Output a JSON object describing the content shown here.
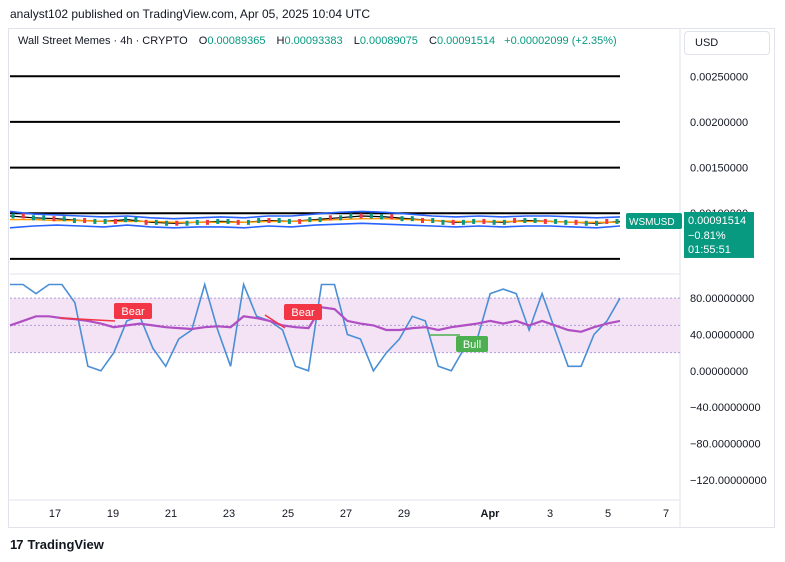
{
  "header": {
    "published": "analyst102 published on TradingView.com, Apr 05, 2025 10:04 UTC"
  },
  "legend": {
    "symbol": "Wall Street Memes · 4h · CRYPTO",
    "o_label": "O",
    "o": "0.00089365",
    "h_label": "H",
    "h": "0.00093383",
    "l_label": "L",
    "l": "0.00089075",
    "c_label": "C",
    "c": "0.00091514",
    "change": "+0.00002099 (+2.35%)"
  },
  "currency_button": "USD",
  "price_tag": {
    "ticker": "WSMUSD",
    "price": "0.00091514",
    "change": "−0.81%",
    "countdown": "01:55:51"
  },
  "colors": {
    "up": "#089981",
    "down": "#f23645",
    "bb": "#2962ff",
    "ma": "#ff9800",
    "stoch_k": "#4a8fd6",
    "stoch_d": "#b04ec4",
    "band": "#f3e3f5"
  },
  "footer": {
    "brand": "TradingView"
  },
  "chart_data": [
    {
      "type": "line",
      "panel": "price",
      "y_axis_ticks": [
        "0.00250000",
        "0.00200000",
        "0.00150000",
        "0.00100000"
      ],
      "ylim": [
        0.0004,
        0.0027
      ],
      "horizontal_lines": [
        0.0025,
        0.002,
        0.0015,
        0.001,
        0.0005
      ],
      "x_ticks": [
        "17",
        "19",
        "21",
        "23",
        "25",
        "27",
        "29",
        "Apr",
        "3",
        "5",
        "7"
      ],
      "series": [
        {
          "values": [
            0.00097,
            0.00095,
            0.00094,
            0.00092,
            0.00091,
            0.00093,
            0.0009,
            0.00089,
            0.0009,
            0.00091,
            0.0009,
            0.00092,
            0.00091,
            0.00093,
            0.00095,
            0.00097,
            0.00096,
            0.00094,
            0.00092,
            0.0009,
            0.00091,
            0.0009,
            0.00092,
            0.00091,
            0.0009,
            0.00089,
            0.00091
          ]
        },
        {
          "values": [
            0.00102,
            0.00099,
            0.00098,
            0.00097,
            0.00096,
            0.00097,
            0.00095,
            0.00094,
            0.00095,
            0.00096,
            0.00095,
            0.00097,
            0.00097,
            0.00099,
            0.00101,
            0.00102,
            0.00101,
            0.00099,
            0.00097,
            0.00096,
            0.00097,
            0.00096,
            0.00097,
            0.00097,
            0.00096,
            0.00095,
            0.00096
          ]
        },
        {
          "values": [
            0.00084,
            0.00086,
            0.00087,
            0.00086,
            0.00085,
            0.00087,
            0.00085,
            0.00084,
            0.00085,
            0.00085,
            0.00084,
            0.00086,
            0.00085,
            0.00087,
            0.00088,
            0.00089,
            0.00088,
            0.00087,
            0.00086,
            0.00085,
            0.00086,
            0.00085,
            0.00086,
            0.00086,
            0.00085,
            0.00084,
            0.00086
          ]
        },
        {
          "values": [
            0.00093,
            0.00093,
            0.00092,
            0.00092,
            0.00091,
            0.00091,
            0.00091,
            0.0009,
            0.0009,
            0.0009,
            0.0009,
            0.00091,
            0.00091,
            0.00092,
            0.00093,
            0.00094,
            0.00094,
            0.00093,
            0.00092,
            0.00091,
            0.00091,
            0.00091,
            0.00091,
            0.00091,
            0.0009,
            0.0009,
            0.0009
          ]
        }
      ]
    },
    {
      "type": "line",
      "panel": "stochastic",
      "y_axis_ticks": [
        "80.00000000",
        "40.00000000",
        "0.00000000",
        "−40.00000000",
        "−80.00000000",
        "−120.00000000"
      ],
      "ylim": [
        -140,
        100
      ],
      "band": [
        20,
        80
      ],
      "series": [
        {
          "values": [
            95,
            95,
            85,
            95,
            95,
            75,
            5,
            0,
            20,
            55,
            60,
            25,
            5,
            35,
            45,
            95,
            45,
            5,
            95,
            60,
            55,
            45,
            5,
            0,
            95,
            95,
            40,
            35,
            0,
            20,
            35,
            60,
            55,
            5,
            0,
            25,
            35,
            85,
            90,
            85,
            45,
            85,
            45,
            5,
            5,
            40,
            55,
            80
          ]
        },
        {
          "values": [
            50,
            55,
            60,
            60,
            58,
            57,
            55,
            52,
            48,
            50,
            52,
            50,
            48,
            47,
            46,
            48,
            49,
            48,
            60,
            58,
            55,
            50,
            48,
            47,
            70,
            68,
            55,
            52,
            50,
            45,
            45,
            47,
            48,
            45,
            48,
            50,
            52,
            55,
            52,
            55,
            50,
            55,
            50,
            45,
            43,
            48,
            52,
            55
          ]
        }
      ],
      "annotations": [
        "Bear",
        "Bear",
        "Bull"
      ]
    }
  ]
}
